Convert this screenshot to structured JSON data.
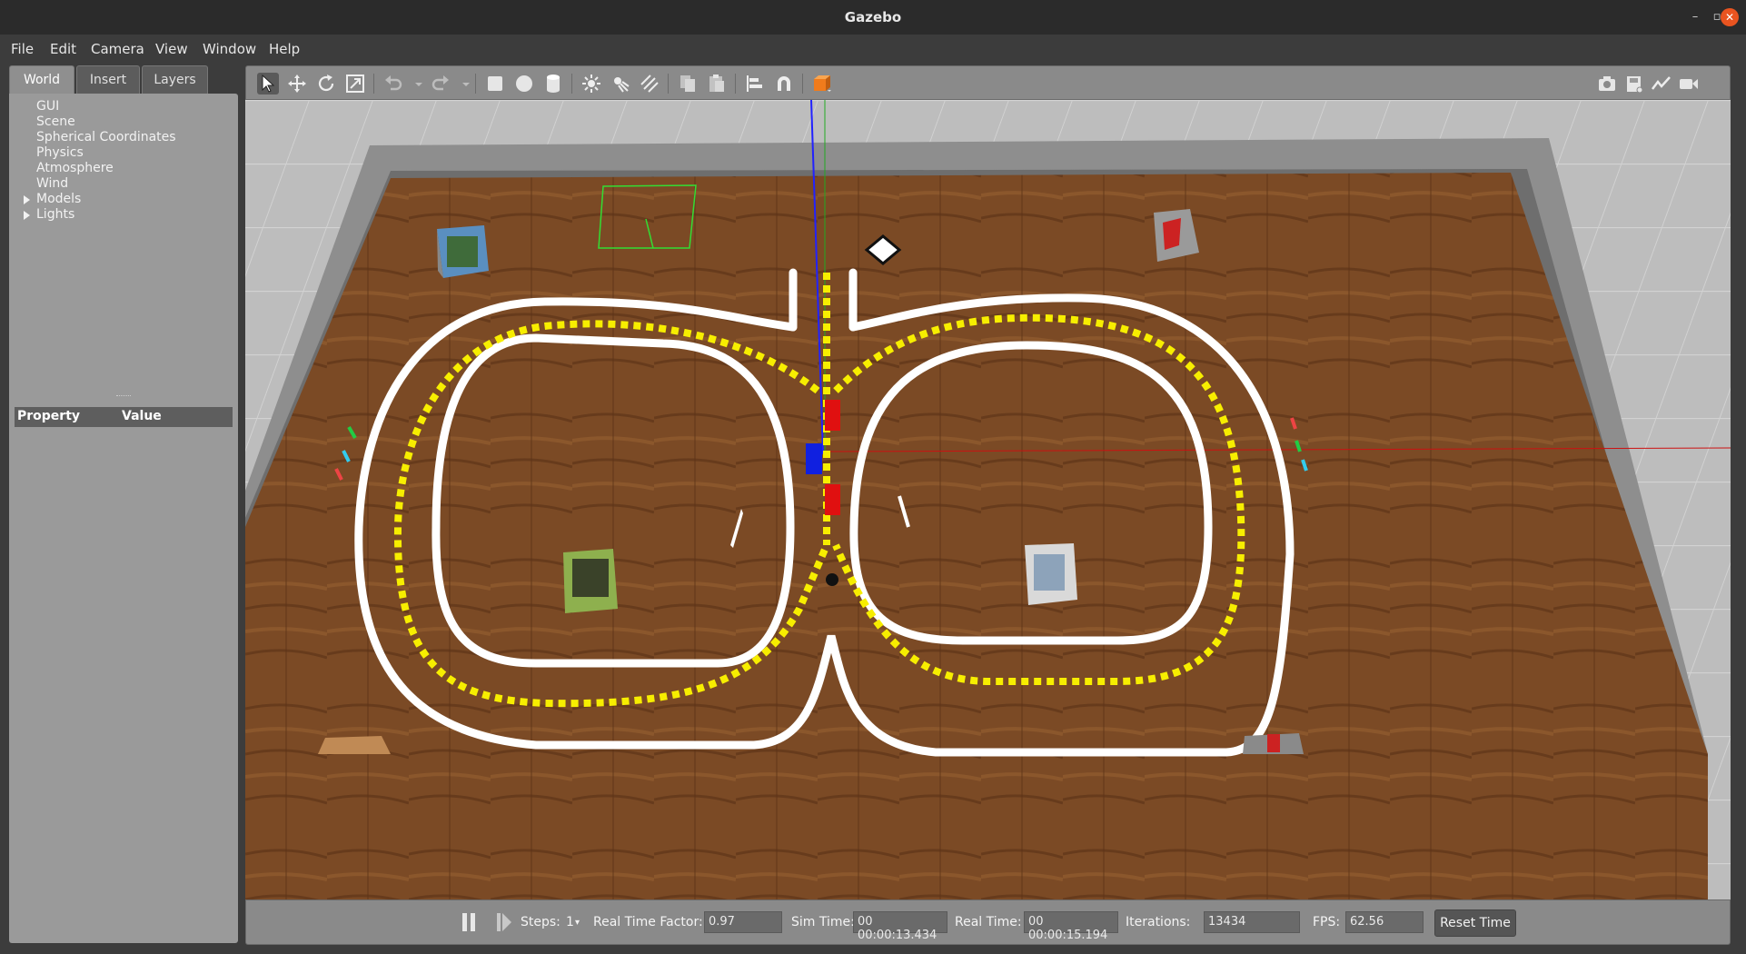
{
  "window": {
    "title": "Gazebo"
  },
  "menu": [
    "File",
    "Edit",
    "Camera",
    "View",
    "Window",
    "Help"
  ],
  "left_panel": {
    "tabs": [
      "World",
      "Insert",
      "Layers"
    ],
    "active_tab": "World",
    "tree": [
      "GUI",
      "Scene",
      "Spherical Coordinates",
      "Physics",
      "Atmosphere",
      "Wind",
      "Models",
      "Lights"
    ],
    "expandable": [
      "Models",
      "Lights"
    ],
    "property_header": {
      "property": "Property",
      "value": "Value"
    }
  },
  "toolbar": {
    "tools": [
      "select-mode",
      "translate-mode",
      "rotate-mode",
      "scale-mode",
      "undo",
      "redo",
      "box-shape",
      "sphere-shape",
      "cylinder-shape",
      "point-light",
      "spot-light",
      "directional-light",
      "copy",
      "paste",
      "align",
      "snap",
      "change-view"
    ],
    "right_tools": [
      "screenshot",
      "log",
      "plot",
      "record-video"
    ]
  },
  "status": {
    "steps_label": "Steps:",
    "steps_value": "1",
    "rtf_label": "Real Time Factor:",
    "rtf_value": "0.97",
    "sim_time_label": "Sim Time:",
    "sim_time_value": "00 00:00:13.434",
    "real_time_label": "Real Time:",
    "real_time_value": "00 00:00:15.194",
    "iterations_label": "Iterations:",
    "iterations_value": "13434",
    "fps_label": "FPS:",
    "fps_value": "62.56",
    "reset_label": "Reset Time"
  },
  "colors": {
    "floor_wood": "#7a4a24",
    "wall": "#8c8c8c",
    "line_white": "#ffffff",
    "line_yellow": "#f5ec00",
    "marker_red": "#e01010",
    "marker_blue": "#1020e0"
  }
}
